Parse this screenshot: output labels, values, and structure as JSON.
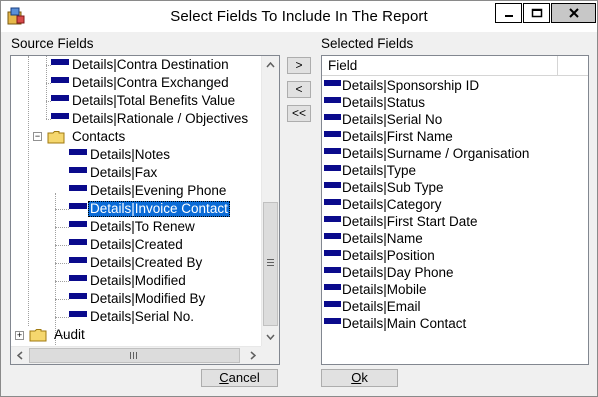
{
  "window": {
    "title": "Select Fields To Include In The Report"
  },
  "source": {
    "label": "Source Fields",
    "rows": [
      {
        "text": "Details|Contra Destination"
      },
      {
        "text": "Details|Contra Exchanged"
      },
      {
        "text": "Details|Total Benefits Value"
      },
      {
        "text": "Details|Rationale / Objectives"
      },
      {
        "text": "Contacts"
      },
      {
        "text": "Details|Notes"
      },
      {
        "text": "Details|Fax"
      },
      {
        "text": "Details|Evening Phone"
      },
      {
        "text": "Details|Invoice Contact"
      },
      {
        "text": "Details|To Renew"
      },
      {
        "text": "Details|Created"
      },
      {
        "text": "Details|Created By"
      },
      {
        "text": "Details|Modified"
      },
      {
        "text": "Details|Modified By"
      },
      {
        "text": "Details|Serial No."
      },
      {
        "text": "Audit"
      }
    ]
  },
  "move_buttons": {
    "add": ">",
    "remove": "<",
    "remove_all": "<<"
  },
  "selected": {
    "label": "Selected Fields",
    "column_header": "Field",
    "rows": [
      "Details|Sponsorship ID",
      "Details|Status",
      "Details|Serial No",
      "Details|First Name",
      "Details|Surname / Organisation",
      "Details|Type",
      "Details|Sub Type",
      "Details|Category",
      "Details|First Start Date",
      "Details|Name",
      "Details|Position",
      "Details|Day Phone",
      "Details|Mobile",
      "Details|Email",
      "Details|Main Contact"
    ]
  },
  "buttons": {
    "cancel_first": "C",
    "cancel_rest": "ancel",
    "ok_first": "O",
    "ok_rest": "k"
  }
}
